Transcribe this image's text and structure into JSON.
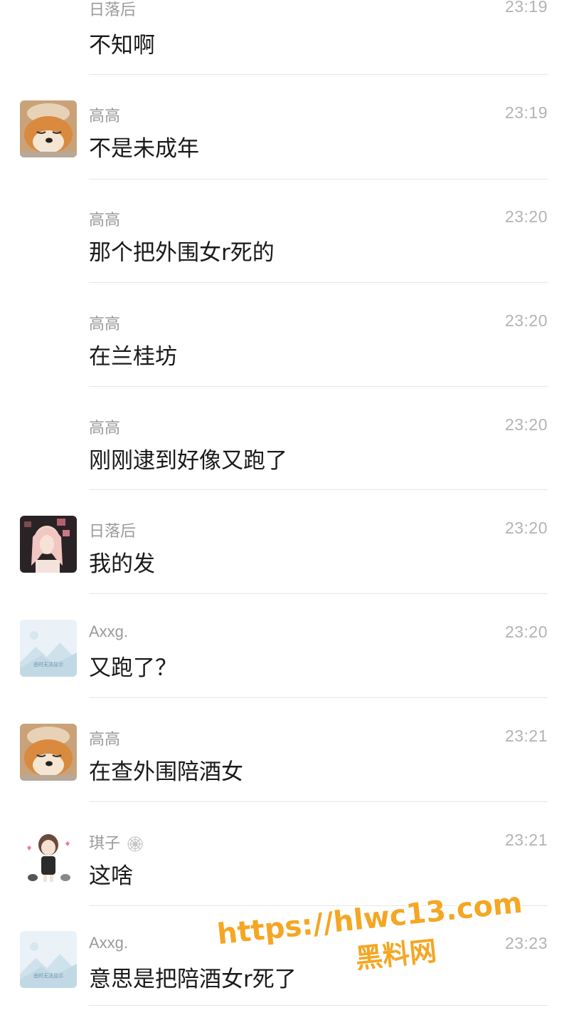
{
  "messages": [
    {
      "sender": "日落后",
      "time": "23:19",
      "text": "不知啊",
      "avatar": "none"
    },
    {
      "sender": "高高",
      "time": "23:19",
      "text": "不是未成年",
      "avatar": "shiba-dog-avatar"
    },
    {
      "sender": "高高",
      "time": "23:20",
      "text": "那个把外围女r死的",
      "avatar": "none"
    },
    {
      "sender": "高高",
      "time": "23:20",
      "text": "在兰桂坊",
      "avatar": "none"
    },
    {
      "sender": "高高",
      "time": "23:20",
      "text": "刚刚逮到好像又跑了",
      "avatar": "none"
    },
    {
      "sender": "日落后",
      "time": "23:20",
      "text": "我的发",
      "avatar": "girl-photo-avatar"
    },
    {
      "sender": "Axxg.",
      "time": "23:20",
      "text": "又跑了？",
      "avatar": "placeholder-avatar"
    },
    {
      "sender": "高高",
      "time": "23:21",
      "text": "在查外围陪酒女",
      "avatar": "shiba-dog-avatar"
    },
    {
      "sender": "琪子",
      "time": "23:21",
      "text": "这啥",
      "avatar": "cartoon-girl-avatar"
    },
    {
      "sender": "Axxg.",
      "time": "23:23",
      "text": "意思是把陪酒女r死了",
      "avatar": "placeholder-avatar"
    }
  ],
  "placeholder_avatar_caption": "由时无法显示",
  "watermark": {
    "line1": "https://hlwc13.com",
    "line2": "黑料网",
    "color": "#f5a623"
  }
}
